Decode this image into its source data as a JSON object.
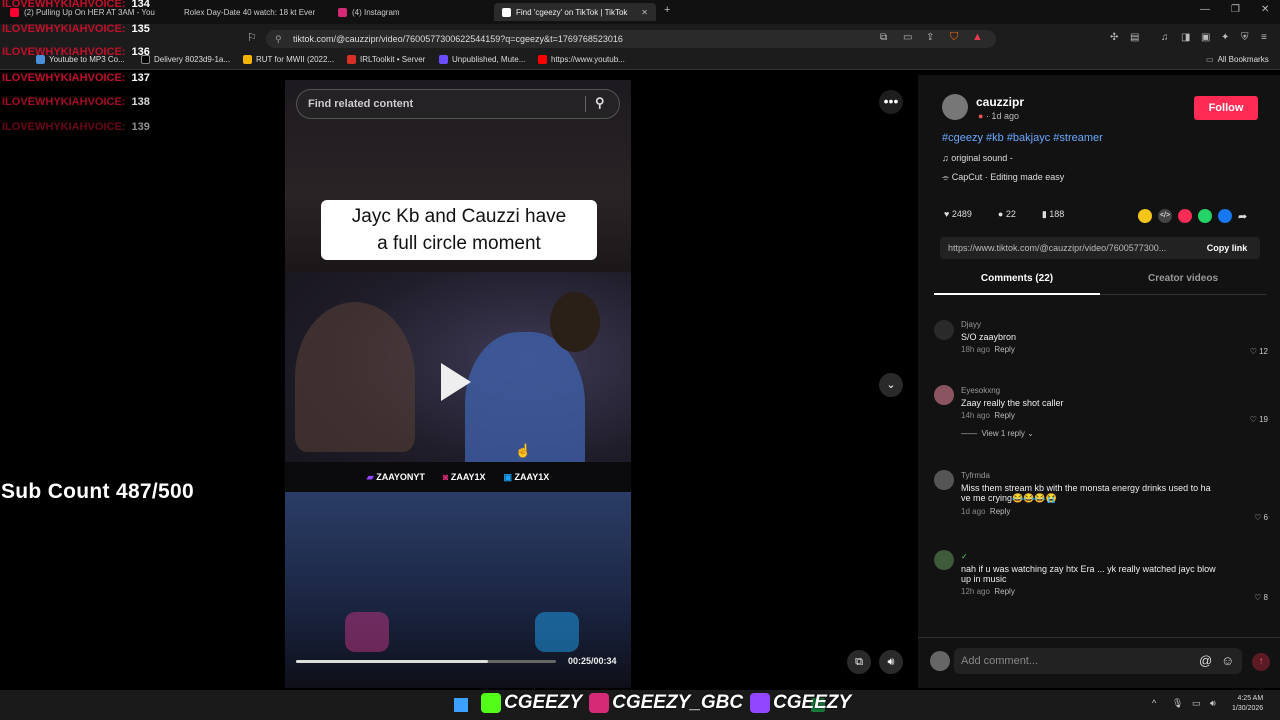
{
  "browser": {
    "tabs": [
      {
        "label": "(2) Pulling Up On HER AT 3AM - You",
        "color": "#ff0033"
      },
      {
        "label": "Rolex Day-Date 40 watch: 18 kt Ever",
        "color": "#777777"
      },
      {
        "label": "(4) Instagram",
        "color": "#d62976"
      },
      {
        "label": "Find 'cgeezy' on TikTok | TikTok",
        "color": "#ffffff"
      }
    ],
    "url": "tiktok.com/@cauzzipr/video/7600577300622544159?q=cgeezy&t=1769768523016",
    "bookmarks": [
      {
        "label": "Youtube to MP3 Co...",
        "color": "#4a90d9"
      },
      {
        "label": "Delivery 8023d9-1a...",
        "color": "#000000"
      },
      {
        "label": "RUT for MWII (2022...",
        "color": "#f4b400"
      },
      {
        "label": "IRLToolkit • Server",
        "color": "#d93025"
      },
      {
        "label": "Unpublished, Mute...",
        "color": "#6b4cff"
      },
      {
        "label": "https://www.youtub...",
        "color": "#ff0000"
      }
    ],
    "all_bookmarks": "All Bookmarks"
  },
  "overlay": {
    "rows": [
      {
        "name": "ILOVEWHYKIAHVOICE:",
        "num": "134"
      },
      {
        "name": "ILOVEWHYKIAHVOICE:",
        "num": "135"
      },
      {
        "name": "ILOVEWHYKIAHVOICE:",
        "num": "136"
      },
      {
        "name": "ILOVEWHYKIAHVOICE:",
        "num": "137"
      },
      {
        "name": "ILOVEWHYKIAHVOICE:",
        "num": "138"
      },
      {
        "name": "ILOVEWHYKIAHVOICE:",
        "num": "139"
      }
    ],
    "sub_count": "Sub Count 487/500"
  },
  "video": {
    "search_placeholder": "Find related content",
    "caption_line1": "Jayc Kb and Cauzzi have",
    "caption_line2": "a full circle moment",
    "handles": [
      "ZAAYONYT",
      "ZAAY1X",
      "ZAAY1X"
    ],
    "time": "00:25/00:34",
    "progress": 0.74
  },
  "post": {
    "username": "cauzzipr",
    "meta": "· 1d ago",
    "follow": "Follow",
    "hashtags": "#cgeezy #kb #bakjayc #streamer",
    "sound": "original sound -",
    "capcut": "CapCut · Editing made easy",
    "likes": "2489",
    "comments": "22",
    "saves": "188",
    "link": "https://www.tiktok.com/@cauzzipr/video/7600577300...",
    "copy_link": "Copy link",
    "tab_comments": "Comments (22)",
    "tab_creator": "Creator videos",
    "add_comment": "Add comment...",
    "share_colors": [
      "#f5c518",
      "#444444",
      "#fe2c55",
      "#25d366",
      "#1877f2"
    ]
  },
  "comments": [
    {
      "user": "Djayy",
      "text": "S/O zaaybron",
      "time": "18h ago",
      "reply": "Reply",
      "likes": "12"
    },
    {
      "user": "Eyesokxng",
      "text": "Zaay really the shot caller",
      "time": "14h ago",
      "reply": "Reply",
      "likes": "19",
      "view_reply": "View 1 reply"
    },
    {
      "user": "Tyfrmda",
      "text": "Miss them stream kb with the monsta energy drinks used to ha",
      "text2": "ve me crying😂😂😂😭",
      "time": "1d ago",
      "reply": "Reply",
      "likes": "6"
    },
    {
      "user": "",
      "text": "nah if u was watching zay htx Era ... yk really watched jayc blow",
      "text2": "up in music",
      "time": "12h ago",
      "reply": "Reply",
      "likes": "8"
    }
  ],
  "taskbar": {
    "banner": [
      "CGEEZY",
      "CGEEZY_GBC",
      "CGEEZY"
    ],
    "clock_time": "4:25 AM",
    "clock_date": "1/30/2026"
  }
}
